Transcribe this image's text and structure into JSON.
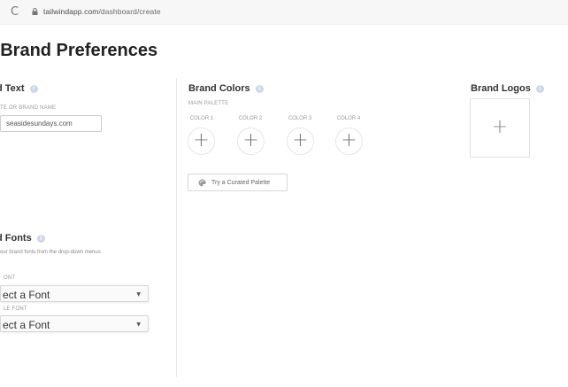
{
  "browser": {
    "reload_glyph": "C",
    "url_host": "tailwindapp.com",
    "url_path": "/dashboard/create"
  },
  "page": {
    "title": "t Brand Preferences"
  },
  "brand_text": {
    "heading": "d Text",
    "field_label": "TE OR BRAND NAME",
    "field_value": "seasidesundays.com"
  },
  "brand_fonts": {
    "heading": "d Fonts",
    "helper": "our brand fonts from the drop-down menus",
    "font1_label": "ONT",
    "font1_value": "ect a Font",
    "font2_label": "LE FONT",
    "font2_value": "ect a Font",
    "caret_glyph": "▼"
  },
  "brand_colors": {
    "heading": "Brand Colors",
    "palette_label": "MAIN PALETTE",
    "colors": [
      {
        "label": "COLOR 1",
        "glyph": "+"
      },
      {
        "label": "COLOR 2",
        "glyph": "+"
      },
      {
        "label": "COLOR 3",
        "glyph": "+"
      },
      {
        "label": "COLOR 4",
        "glyph": "+"
      }
    ],
    "curated_button": "Try a Curated Palette"
  },
  "brand_logos": {
    "heading": "Brand Logos",
    "add_glyph": "+"
  },
  "info_glyph": "i",
  "colors": {
    "info_icon": "#cfd6e6",
    "border": "#e6e6e6"
  },
  "icons": [
    "reload-icon",
    "lock-icon",
    "info-icon",
    "palette-icon",
    "plus-icon",
    "caret-down-icon"
  ]
}
